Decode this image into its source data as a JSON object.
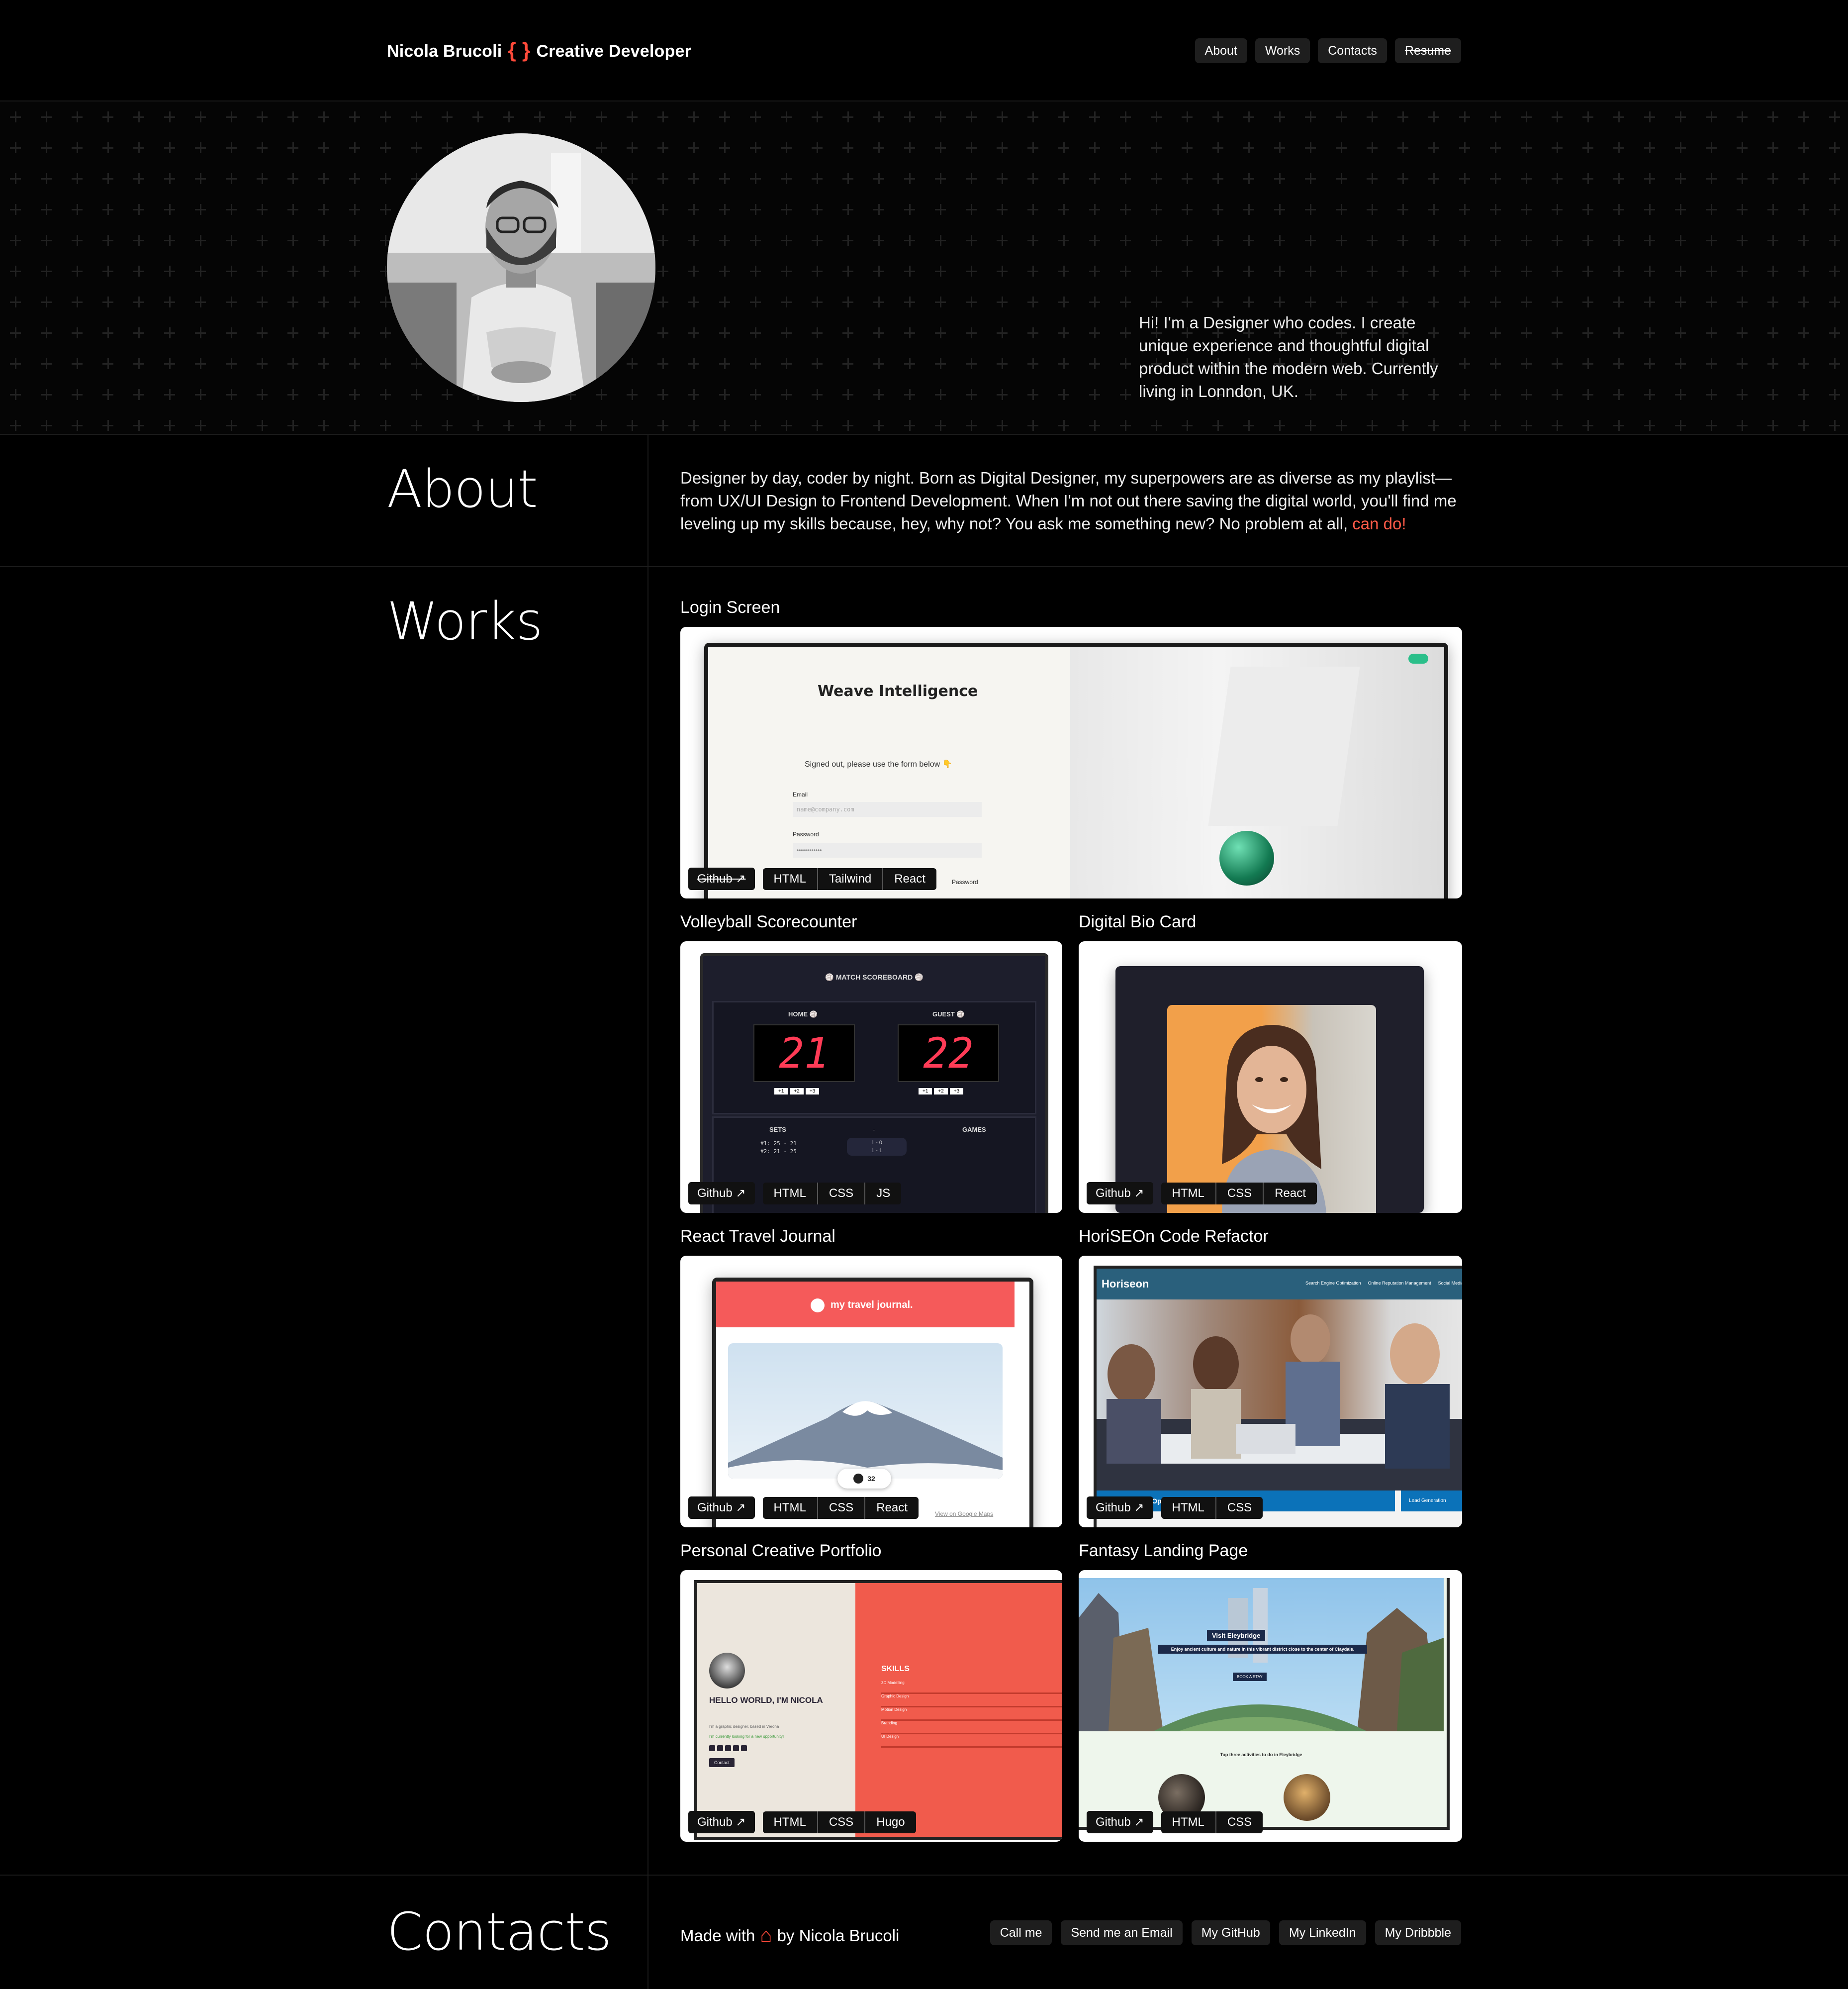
{
  "header": {
    "name": "Nicola Brucoli",
    "braces": "{ }",
    "role": "Creative Developer",
    "nav": [
      "About",
      "Works",
      "Contacts",
      "Resume"
    ]
  },
  "hero": {
    "intro": "Hi! I'm a Designer who codes. I create unique experience and thoughtful digital product within the modern web. Currently living in Lonndon, UK."
  },
  "about": {
    "title": "About",
    "text": "Designer by day, coder by night. Born as Digital Designer, my superpowers are as diverse as my playlist—from UX/UI Design to Frontend Development. When I'm not out there saving the digital world, you'll find me leveling up my skills because, hey, why not? You ask me something new? No problem at all,",
    "accent": "can do!"
  },
  "works": {
    "title": "Works",
    "items": [
      {
        "title": "Login Screen",
        "github": "Github ↗",
        "tags": [
          "HTML",
          "Tailwind",
          "React"
        ],
        "preview": {
          "heading": "Weave Intelligence",
          "message": "Signed out, please use the form below 👇",
          "email_label": "Email",
          "email_placeholder": "name@company.com",
          "password_label": "Password",
          "password_value": "••••••••••••",
          "small": "Password"
        }
      },
      {
        "title": "Volleyball Scorecounter",
        "github": "Github ↗",
        "tags": [
          "HTML",
          "CSS",
          "JS"
        ],
        "preview": {
          "header": "🏐 MATCH SCOREBOARD 🏐",
          "home": "HOME 🏐",
          "guest": "GUEST 🏐",
          "home_score": "21",
          "guest_score": "22",
          "sets": "SETS",
          "dash": "-",
          "games": "GAMES",
          "set_lines": [
            "#1: 25 - 21",
            "#2: 21 - 25"
          ],
          "game_lines": [
            "1 - 0",
            "1 - 1"
          ],
          "btns": [
            "+1",
            "+2",
            "+3"
          ]
        }
      },
      {
        "title": "Digital Bio Card",
        "github": "Github ↗",
        "tags": [
          "HTML",
          "CSS",
          "React"
        ]
      },
      {
        "title": "React Travel Journal",
        "github": "Github ↗",
        "tags": [
          "HTML",
          "CSS",
          "React"
        ],
        "preview": {
          "brand": "my travel journal.",
          "likes": "32",
          "maps": "View on Google Maps"
        }
      },
      {
        "title": "HoriSEOn Code Refactor",
        "github": "Github ↗",
        "tags": [
          "HTML",
          "CSS"
        ],
        "preview": {
          "brand": "Horiseon",
          "menu": [
            "Search Engine Optimization",
            "Online Reputation Management",
            "Social Media M"
          ],
          "banner": "Search Engine Optimization",
          "side": "Lead Generation"
        }
      },
      {
        "title": "Personal Creative Portfolio",
        "github": "Github ↗",
        "tags": [
          "HTML",
          "CSS",
          "Hugo"
        ],
        "preview": {
          "hello": "HELLO WORLD, I'M NICOLA",
          "sub": "I'm a graphic designer, based in Verona",
          "green": "I'm currently looking for a new opportunity!",
          "contact": "Contact",
          "skills": "SKILLS",
          "skill_list": [
            "3D Modelling",
            "Graphic Design",
            "Motion Design",
            "Branding",
            "UI Design"
          ]
        }
      },
      {
        "title": "Fantasy Landing Page",
        "github": "Github ↗",
        "tags": [
          "HTML",
          "CSS"
        ],
        "preview": {
          "visit": "Visit Eleybridge",
          "desc": "Enjoy ancient culture and nature in this vibrant district close to the center of Claydale.",
          "book": "BOOK A STAY",
          "top": "Top three activities to do in Eleybridge"
        }
      }
    ]
  },
  "contacts": {
    "title": "Contacts",
    "made_with": "Made with",
    "by": "by Nicola Brucoli",
    "links": [
      "Call me",
      "Send me an Email",
      "My GitHub",
      "My LinkedIn",
      "My Dribbble"
    ]
  },
  "colors": {
    "accent": "#ff4a3a",
    "background": "#000000",
    "pill": "#1e1e1e"
  }
}
